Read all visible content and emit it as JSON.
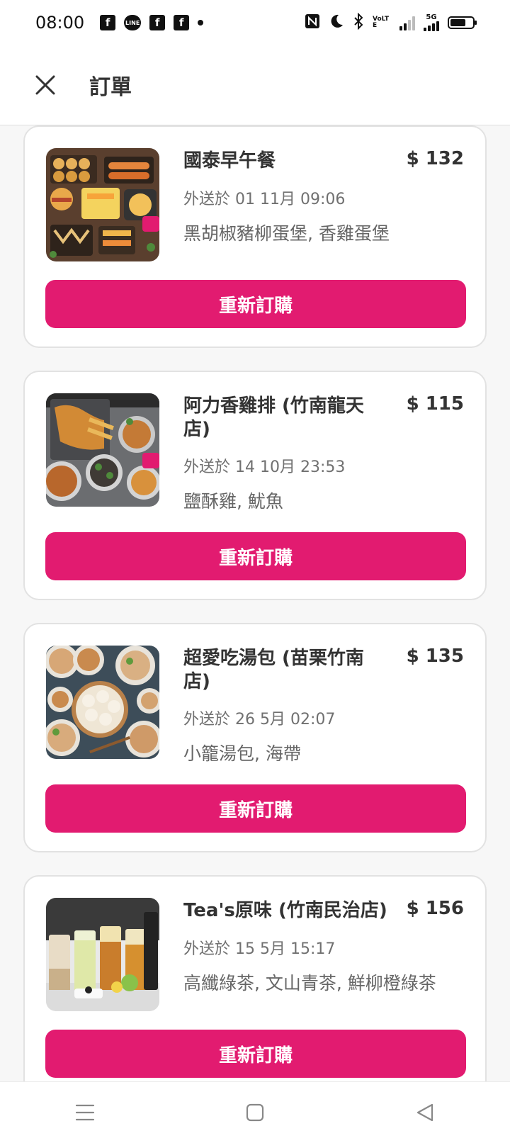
{
  "status_bar": {
    "time": "08:00",
    "network": "5G",
    "volte": "VoLTE"
  },
  "header": {
    "title": "訂單"
  },
  "orders": [
    {
      "name": "國泰早午餐",
      "price": "$ 132",
      "delivered": "外送於 01 11月 09:06",
      "items": "黑胡椒豬柳蛋堡, 香雞蛋堡",
      "button": "重新訂購"
    },
    {
      "name": "阿力香雞排 (竹南龍天店)",
      "price": "$ 115",
      "delivered": "外送於 14 10月 23:53",
      "items": "鹽酥雞, 魷魚",
      "button": "重新訂購"
    },
    {
      "name": "超愛吃湯包 (苗栗竹南店)",
      "price": "$ 135",
      "delivered": "外送於 26 5月 02:07",
      "items": "小籠湯包, 海帶",
      "button": "重新訂購"
    },
    {
      "name": "Tea's原味 (竹南民治店)",
      "price": "$ 156",
      "delivered": "外送於 15 5月 15:17",
      "items": "高纖綠茶, 文山青茶, 鮮柳橙綠茶",
      "button": "重新訂購"
    }
  ],
  "colors": {
    "accent": "#e21b70",
    "text": "#333333",
    "muted": "#707070"
  }
}
